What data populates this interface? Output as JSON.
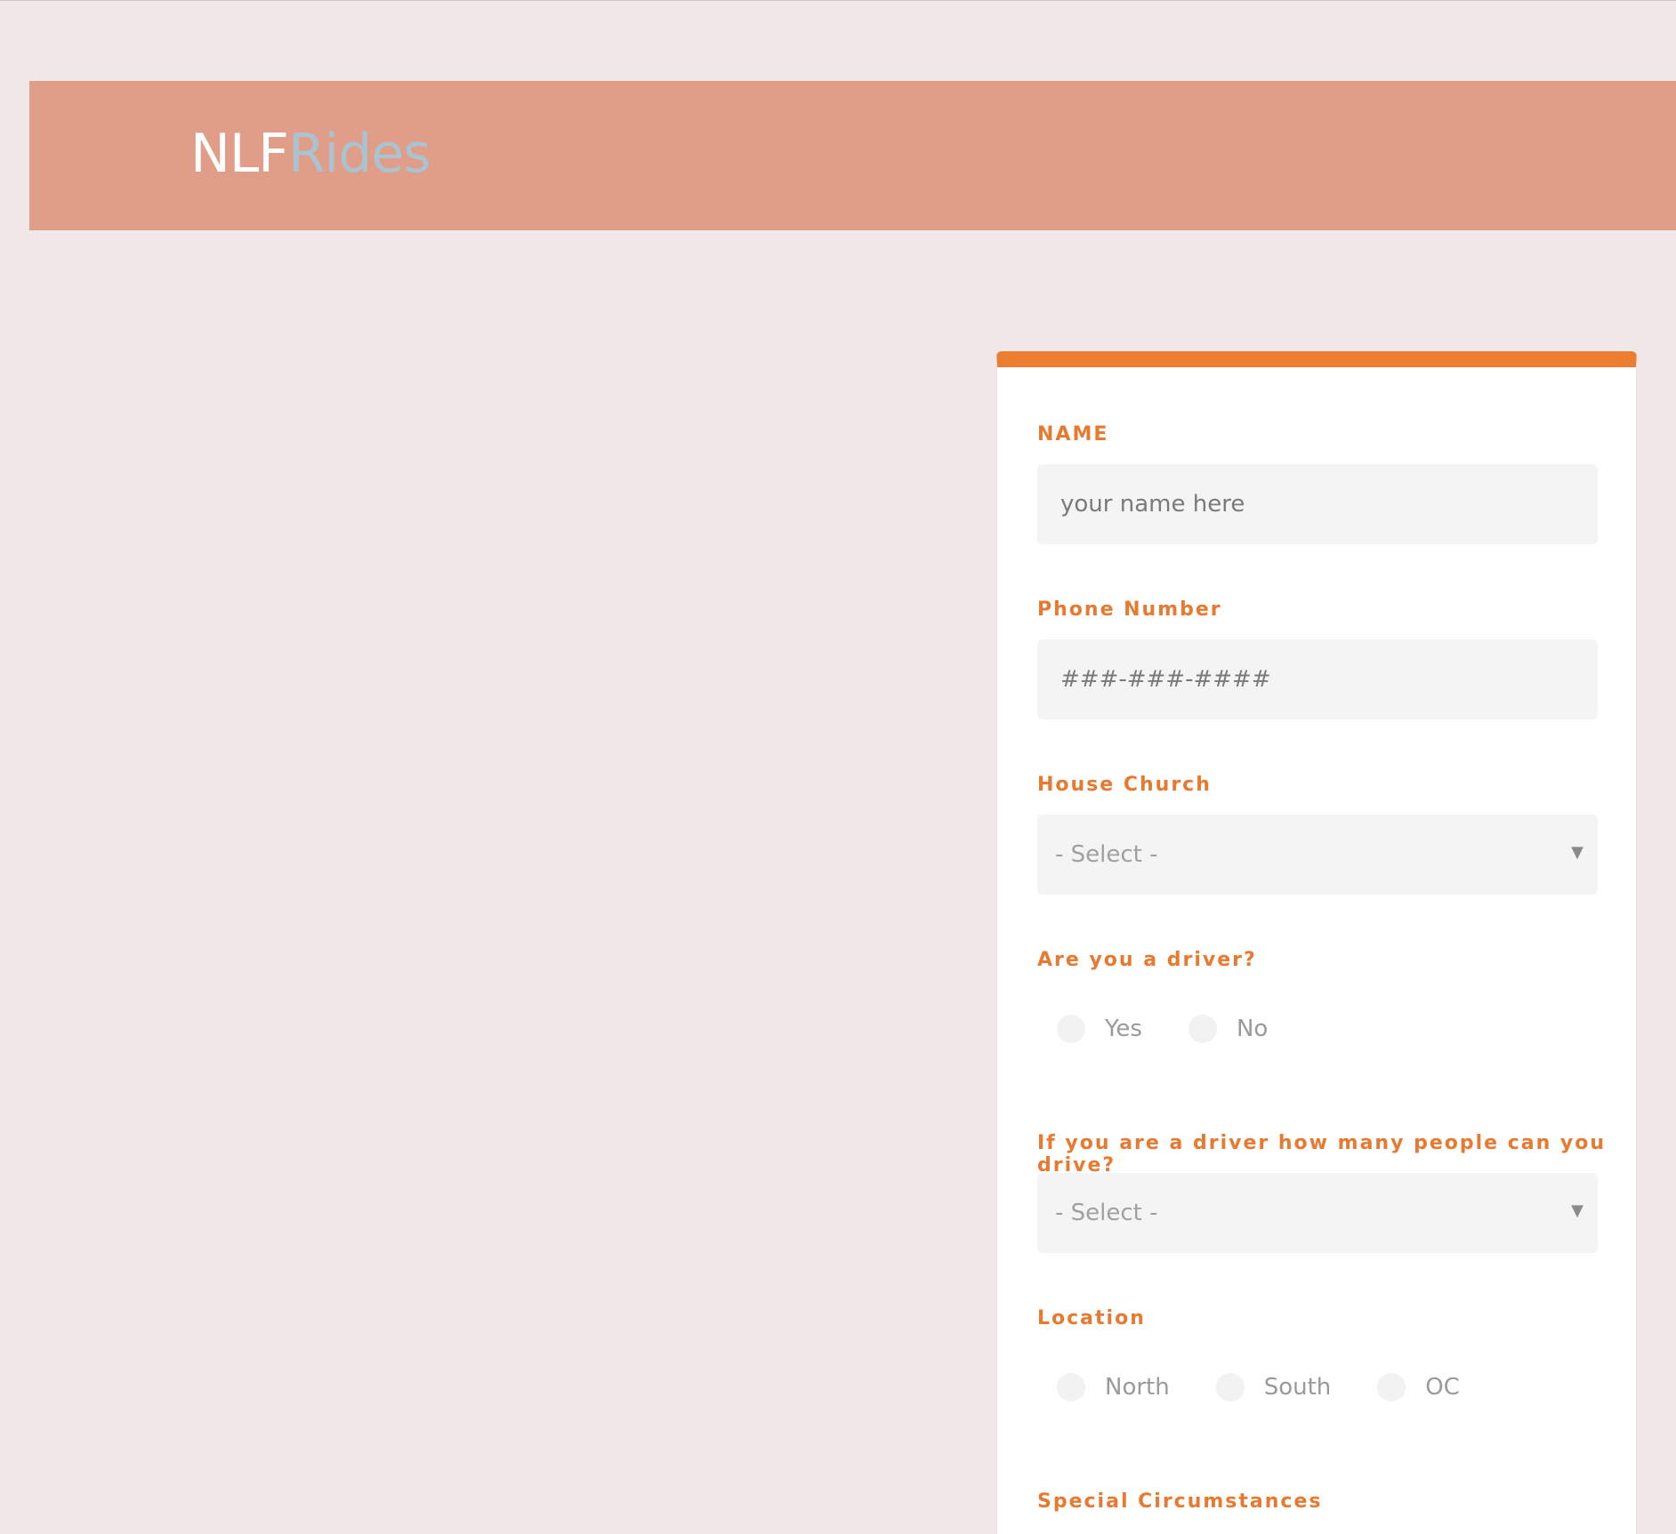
{
  "header": {
    "brand_part1": "NLF",
    "brand_part2": "Rides"
  },
  "form": {
    "name": {
      "label": "NAME",
      "placeholder": "your name here",
      "value": ""
    },
    "phone": {
      "label": "Phone Number",
      "placeholder": "###-###-####",
      "value": ""
    },
    "house_church": {
      "label": "House Church",
      "selected": "- Select -"
    },
    "driver": {
      "label": "Are you a driver?",
      "options": [
        "Yes",
        "No"
      ]
    },
    "capacity": {
      "label": "If you are a driver how many people can you drive?",
      "selected": "- Select -"
    },
    "location": {
      "label": "Location",
      "options": [
        "North",
        "South",
        "OC"
      ]
    },
    "special": {
      "label": "Special Circumstances"
    }
  },
  "icons": {
    "dropdown_arrow": "▼"
  },
  "colors": {
    "background": "#f0e8e6",
    "header": "#e09d88",
    "brand_secondary": "#a9c4d0",
    "accent": "#ec7d31",
    "label": "#e87930",
    "input_bg": "#f4f4f4"
  }
}
